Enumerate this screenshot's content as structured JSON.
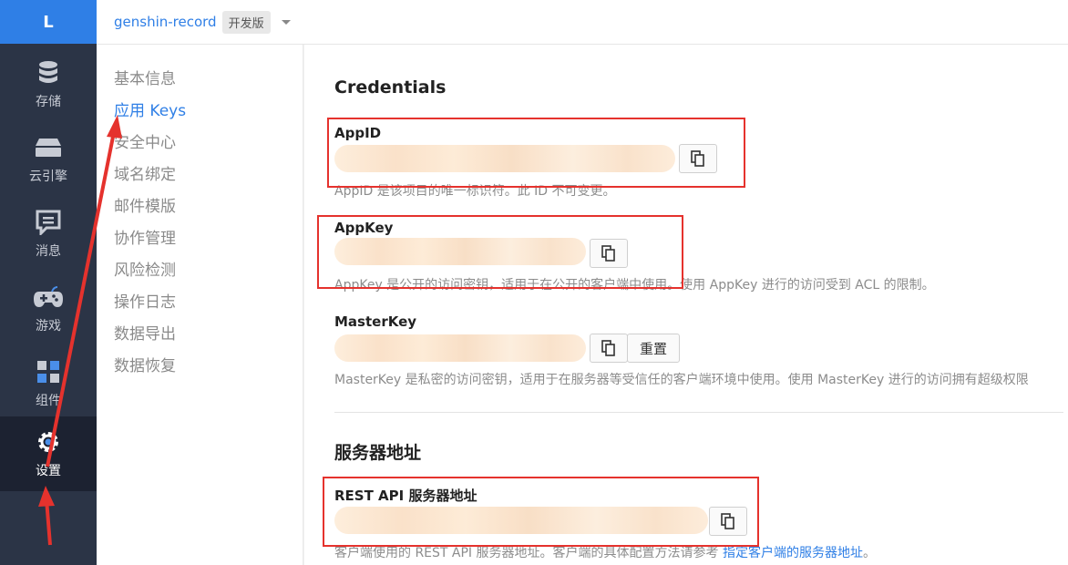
{
  "nav": {
    "logo": "L",
    "items": [
      {
        "label": "存储",
        "icon": "database-icon"
      },
      {
        "label": "云引擎",
        "icon": "cloud-engine-icon"
      },
      {
        "label": "消息",
        "icon": "message-icon"
      },
      {
        "label": "游戏",
        "icon": "gamepad-icon"
      },
      {
        "label": "组件",
        "icon": "components-icon"
      },
      {
        "label": "设置",
        "icon": "gear-icon",
        "active": true
      }
    ]
  },
  "topbar": {
    "app_name": "genshin-record",
    "badge": "开发版"
  },
  "submenu": {
    "items": [
      "基本信息",
      "应用 Keys",
      "安全中心",
      "域名绑定",
      "邮件模版",
      "协作管理",
      "风险检测",
      "操作日志",
      "数据导出",
      "数据恢复"
    ],
    "active_index": 1
  },
  "content": {
    "credentials_title": "Credentials",
    "appid": {
      "label": "AppID",
      "desc": "AppID 是该项目的唯一标识符。此 ID 不可变更。"
    },
    "appkey": {
      "label": "AppKey",
      "desc": "AppKey 是公开的访问密钥，适用于在公开的客户端中使用。使用 AppKey 进行的访问受到 ACL 的限制。"
    },
    "masterkey": {
      "label": "MasterKey",
      "desc": "MasterKey 是私密的访问密钥，适用于在服务器等受信任的客户端环境中使用。使用 MasterKey 进行的访问拥有超级权限",
      "reset_label": "重置"
    },
    "server_title": "服务器地址",
    "rest_api": {
      "label": "REST API 服务器地址",
      "desc": "客户端使用的 REST API 服务器地址。客户端的具体配置方法请参考",
      "link": "指定客户端的服务器地址",
      "end": "。"
    }
  },
  "colors": {
    "accent": "#2f7fe6",
    "nav_bg": "#2b3446",
    "annotation": "#e5322d"
  }
}
